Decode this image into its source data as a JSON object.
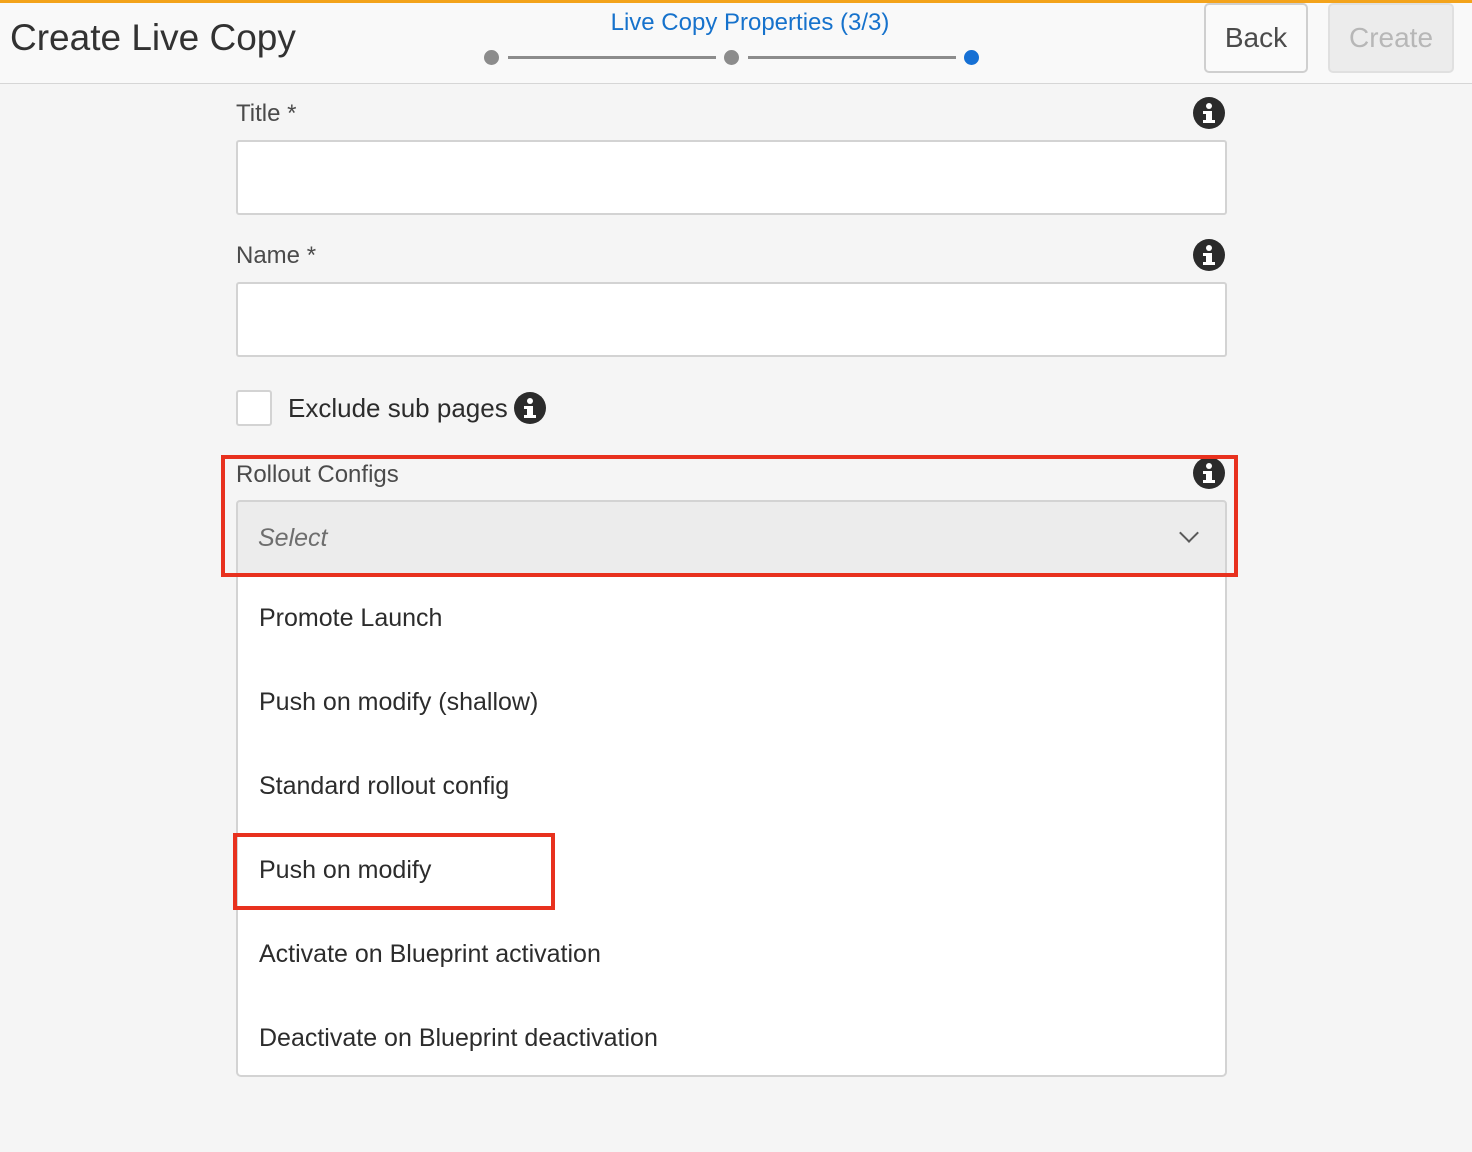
{
  "header": {
    "app_title": "Create Live Copy",
    "step_title": "Live Copy Properties (3/3)",
    "back_label": "Back",
    "create_label": "Create"
  },
  "form": {
    "title_label": "Title *",
    "title_value": "",
    "name_label": "Name *",
    "name_value": "",
    "exclude_label": "Exclude sub pages",
    "exclude_checked": false,
    "rollout_label": "Rollout Configs",
    "rollout_placeholder": "Select"
  },
  "dropdown": {
    "options": [
      "Promote Launch",
      "Push on modify (shallow)",
      "Standard rollout config",
      "Push on modify",
      "Activate on Blueprint activation",
      "Deactivate on Blueprint deactivation"
    ]
  },
  "colors": {
    "accent": "#1672cc",
    "highlight": "#e8311e",
    "top_border": "#f3a31b"
  },
  "icons": [
    "info-icon",
    "chevron-down-icon"
  ]
}
